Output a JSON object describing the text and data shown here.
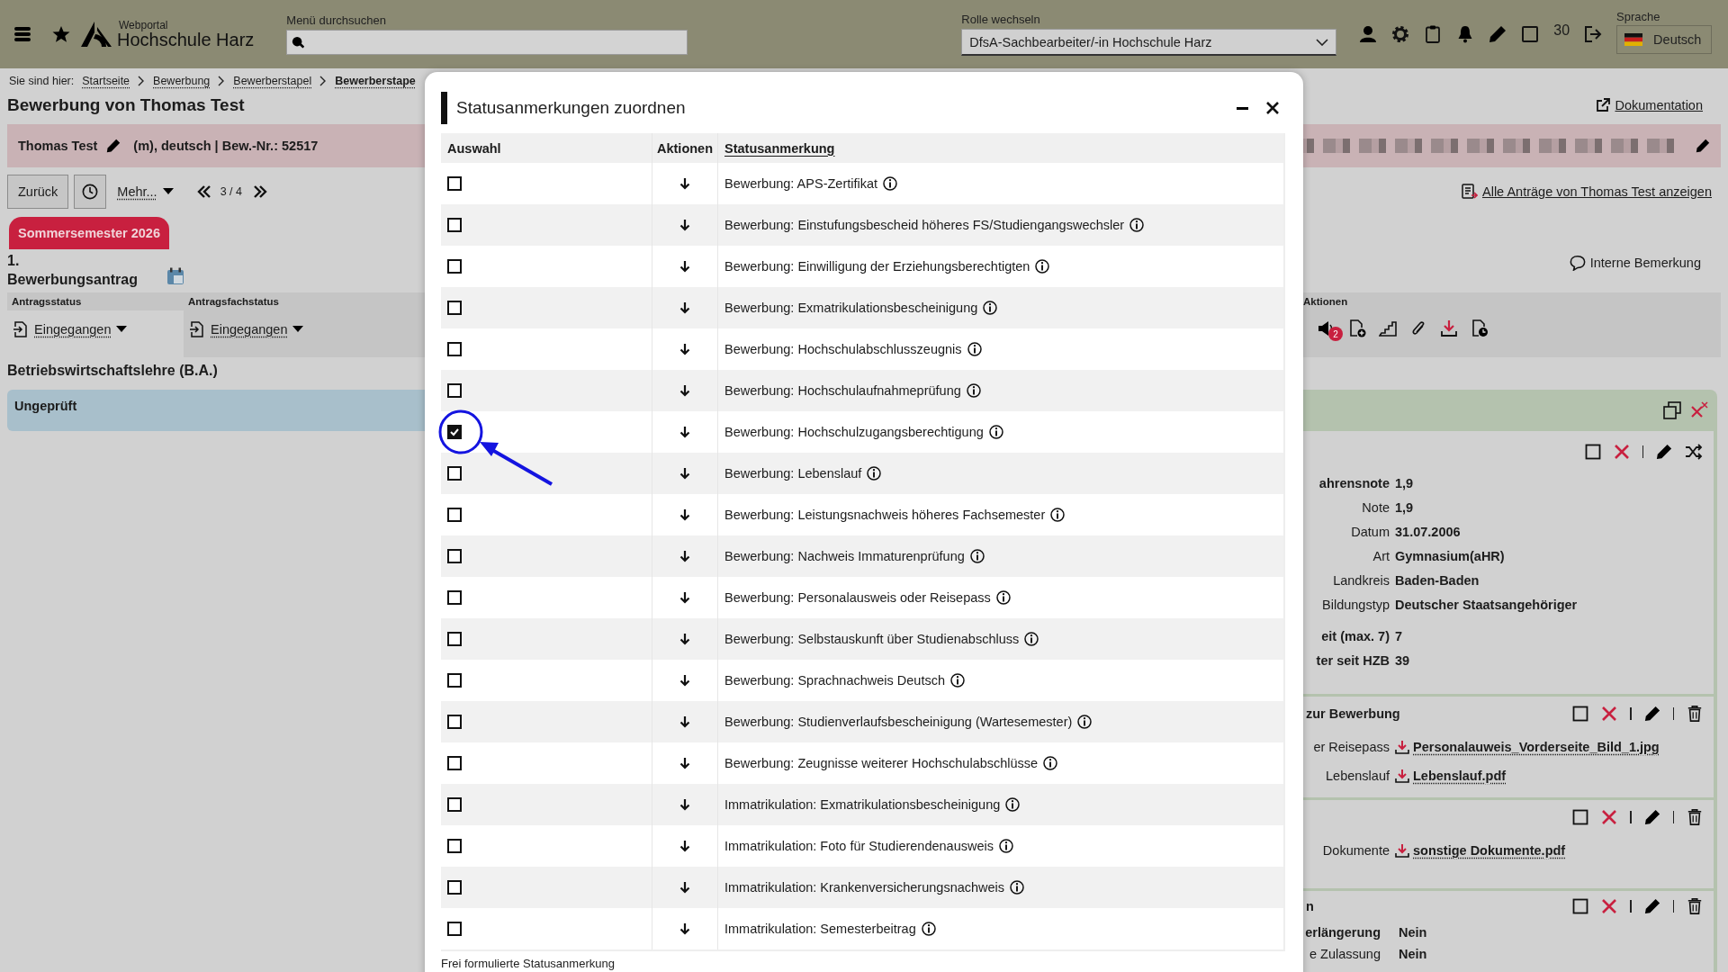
{
  "top_bar": {
    "logo_small": "Webportal",
    "logo_name": "Hochschule Harz",
    "search": {
      "label": "Menü durchsuchen"
    },
    "role": {
      "label": "Rolle wechseln",
      "value": "DfsA-Sachbearbeiter/-in Hochschule Harz"
    },
    "counter": "30",
    "language": {
      "label": "Sprache",
      "value": "Deutsch"
    }
  },
  "breadcrumb": {
    "label": "Sie sind hier:",
    "items": [
      "Startseite",
      "Bewerbung",
      "Bewerberstapel",
      "Bewerberstape"
    ]
  },
  "page_title": "Bewerbung von Thomas Test",
  "documentation_link": "Dokumentation",
  "applicant": {
    "name": "Thomas Test",
    "details": "(m), deutsch | Bew.-Nr.: 52517"
  },
  "toolbar": {
    "back": "Zurück",
    "more": "Mehr...",
    "pager": "3 / 4"
  },
  "all_applications_link": "Alle Anträge von Thomas Test anzeigen",
  "semester_tab": "Sommersemester 2026",
  "application": {
    "number": "1.",
    "title": "Bewerbungsantrag",
    "internal_note": "Interne Bemerkung",
    "actions_label": "Aktionen",
    "notification_count": "2",
    "status_columns": [
      {
        "label": "Antragsstatus",
        "value": "Eingegangen"
      },
      {
        "label": "Antragsfachstatus",
        "value": "Eingegangen"
      }
    ]
  },
  "program": "Betriebswirtschaftslehre (B.A.)",
  "review_status": "Ungeprüft",
  "cards": [
    {
      "kind": "details",
      "field_groups": [
        [
          {
            "label": "ahrensnote",
            "value": "1,9"
          },
          {
            "label": "Note",
            "value": "1,9"
          },
          {
            "label": "Datum",
            "value": "31.07.2006"
          },
          {
            "label": "Art",
            "value": "Gymnasium(aHR)"
          },
          {
            "label": "Landkreis",
            "value": "Baden-Baden"
          },
          {
            "label": "Bildungstyp",
            "value": "Deutscher Staatsangehöriger"
          }
        ],
        [
          {
            "label": "eit (max. 7)",
            "value": "7"
          },
          {
            "label": "ter seit HZB",
            "value": "39"
          }
        ]
      ]
    },
    {
      "kind": "files",
      "header": "zur Bewerbung",
      "files": [
        {
          "label": "er Reisepass",
          "file": "Personalauweis_Vorderseite_Bild_1.jpg"
        },
        {
          "label": "Lebenslauf",
          "file": "Lebenslauf.pdf"
        }
      ]
    },
    {
      "kind": "files",
      "files": [
        {
          "label": "Dokumente",
          "file": "sonstige Dokumente.pdf"
        }
      ]
    },
    {
      "kind": "flags",
      "header": "n",
      "field_groups": [
        [
          {
            "label": "erlängerung",
            "value": "Nein"
          },
          {
            "label": "e Zulassung",
            "value": "Nein"
          }
        ]
      ]
    }
  ],
  "dialog": {
    "title": "Statusanmerkungen zuordnen",
    "columns": [
      "Auswahl",
      "Aktionen",
      "Statusanmerkung"
    ],
    "rows": [
      {
        "text": "Bewerbung: APS-Zertifikat",
        "checked": false
      },
      {
        "text": "Bewerbung: Einstufungsbescheid höheres FS/Studiengangswechsler",
        "checked": false
      },
      {
        "text": "Bewerbung: Einwilligung der Erziehungsberechtigten",
        "checked": false
      },
      {
        "text": "Bewerbung: Exmatrikulationsbescheinigung",
        "checked": false
      },
      {
        "text": "Bewerbung: Hochschulabschlusszeugnis",
        "checked": false
      },
      {
        "text": "Bewerbung: Hochschulaufnahmeprüfung",
        "checked": false
      },
      {
        "text": "Bewerbung: Hochschulzugangsberechtigung",
        "checked": true
      },
      {
        "text": "Bewerbung: Lebenslauf",
        "checked": false
      },
      {
        "text": "Bewerbung: Leistungsnachweis höheres Fachsemester",
        "checked": false
      },
      {
        "text": "Bewerbung: Nachweis Immaturenprüfung",
        "checked": false
      },
      {
        "text": "Bewerbung: Personalausweis oder Reisepass",
        "checked": false
      },
      {
        "text": "Bewerbung: Selbstauskunft über Studienabschluss",
        "checked": false
      },
      {
        "text": "Bewerbung: Sprachnachweis Deutsch",
        "checked": false
      },
      {
        "text": "Bewerbung: Studienverlaufsbescheinigung (Wartesemester)",
        "checked": false
      },
      {
        "text": "Bewerbung: Zeugnisse weiterer Hochschulabschlüsse",
        "checked": false
      },
      {
        "text": "Immatrikulation: Exmatrikulationsbescheinigung",
        "checked": false
      },
      {
        "text": "Immatrikulation: Foto für Studierendenausweis",
        "checked": false
      },
      {
        "text": "Immatrikulation: Krankenversicherungsnachweis",
        "checked": false
      },
      {
        "text": "Immatrikulation: Semesterbeitrag",
        "checked": false
      }
    ],
    "footer_label": "Frei formulierte Statusanmerkung"
  }
}
